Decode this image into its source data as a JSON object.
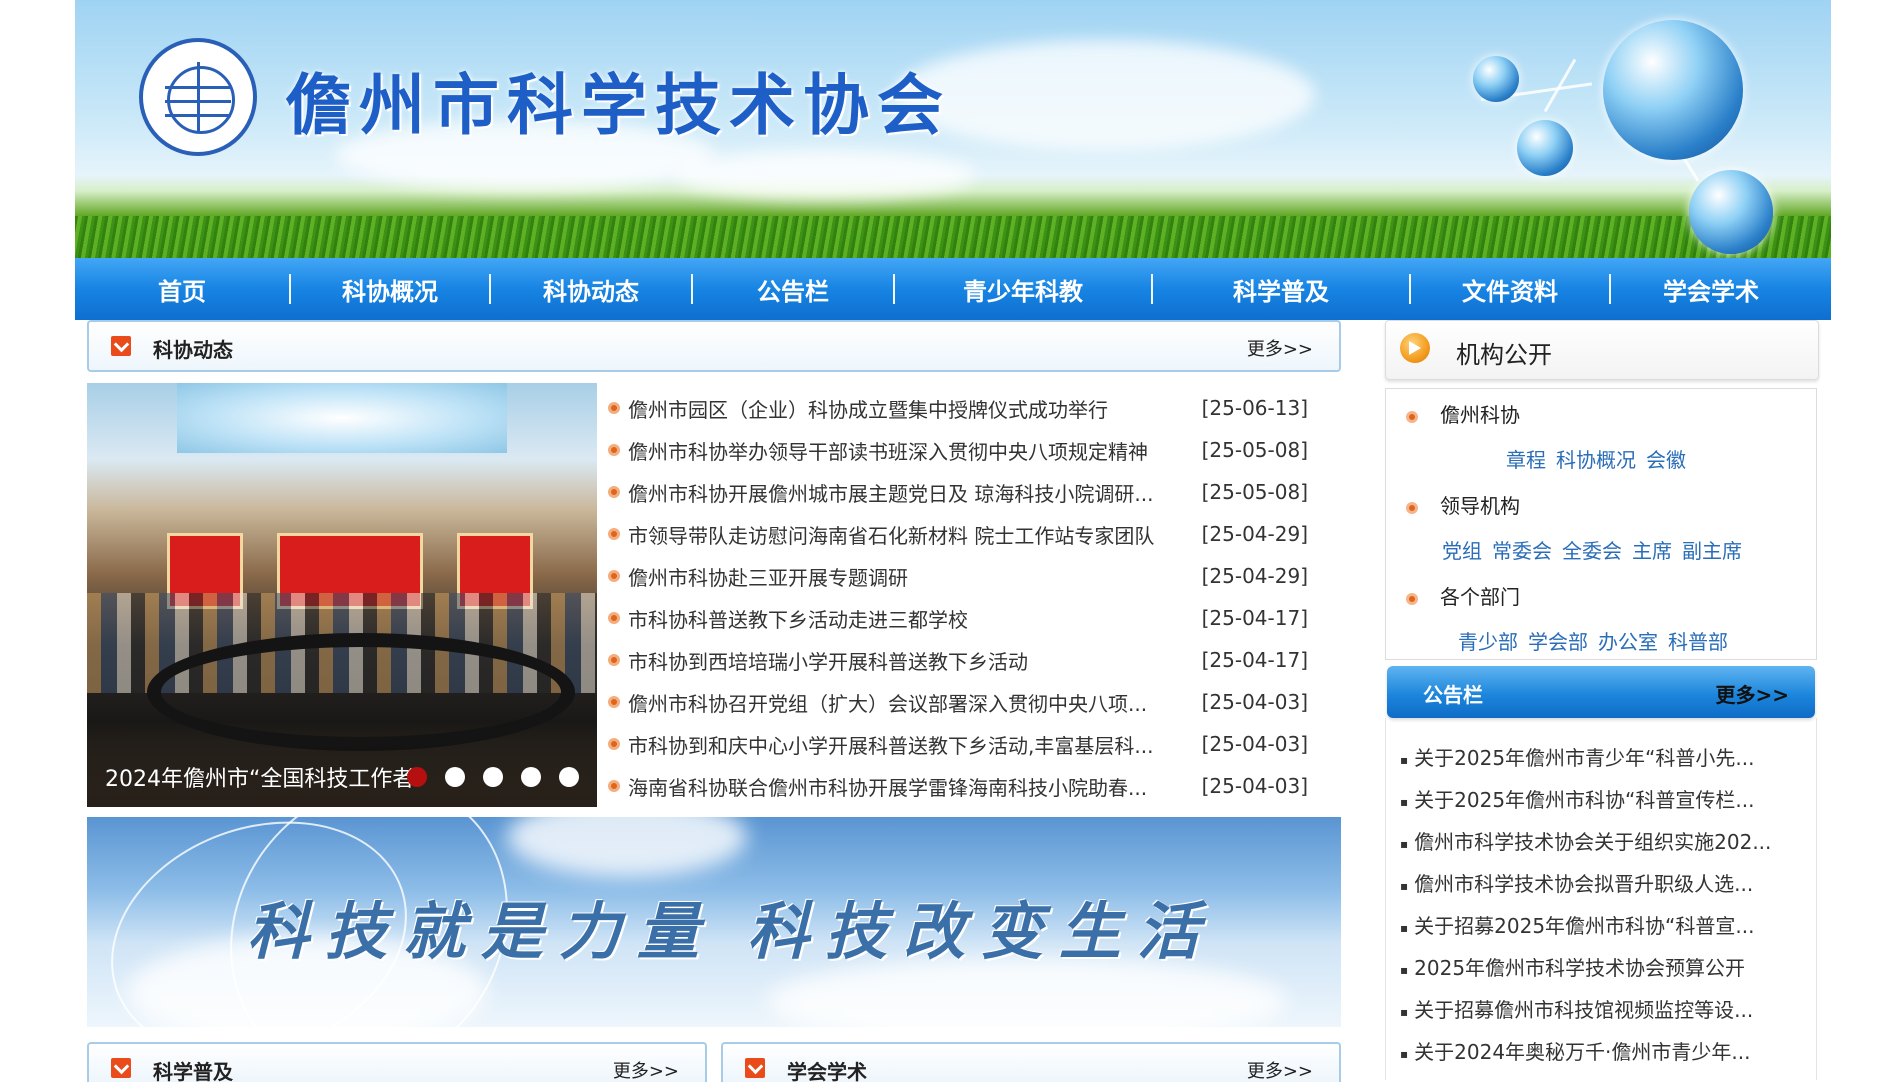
{
  "header": {
    "site_title": "儋州市科学技术协会"
  },
  "nav": {
    "items": [
      {
        "label": "首页"
      },
      {
        "label": "科协概况"
      },
      {
        "label": "科协动态"
      },
      {
        "label": "公告栏"
      },
      {
        "label": "青少年科教"
      },
      {
        "label": "科学普及"
      },
      {
        "label": "文件资料"
      },
      {
        "label": "学会学术"
      }
    ]
  },
  "news": {
    "title": "科协动态",
    "more": "更多>>",
    "slider_caption": "2024年儋州市“全国科技工作者...",
    "items": [
      {
        "title": "儋州市园区（企业）科协成立暨集中授牌仪式成功举行",
        "date": "[25-06-13]"
      },
      {
        "title": "儋州市科协举办领导干部读书班深入贯彻中央八项规定精神",
        "date": "[25-05-08]"
      },
      {
        "title": "儋州市科协开展儋州城市展主题党日及 琼海科技小院调研...",
        "date": "[25-05-08]"
      },
      {
        "title": "市领导带队走访慰问海南省石化新材料 院士工作站专家团队",
        "date": "[25-04-29]"
      },
      {
        "title": "儋州市科协赴三亚开展专题调研",
        "date": "[25-04-29]"
      },
      {
        "title": "市科协科普送教下乡活动走进三都学校",
        "date": "[25-04-17]"
      },
      {
        "title": "市科协到西培培瑞小学开展科普送教下乡活动",
        "date": "[25-04-17]"
      },
      {
        "title": "儋州市科协召开党组（扩大）会议部署深入贯彻中央八项...",
        "date": "[25-04-03]"
      },
      {
        "title": "市科协到和庆中心小学开展科普送教下乡活动,丰富基层科...",
        "date": "[25-04-03]"
      },
      {
        "title": "海南省科协联合儋州市科协开展学雷锋海南科技小院助春...",
        "date": "[25-04-03]"
      }
    ]
  },
  "slogan": {
    "left": "科技就是力量",
    "right": "科技改变生活"
  },
  "sections": {
    "popular_science": {
      "title": "科学普及",
      "more": "更多>>"
    },
    "academic": {
      "title": "学会学术",
      "more": "更多>>"
    }
  },
  "org": {
    "title": "机构公开",
    "groups": [
      {
        "name": "儋州科协",
        "links": [
          "章程",
          "科协概况",
          "会徽"
        ]
      },
      {
        "name": "领导机构",
        "links": [
          "党组",
          "常委会",
          "全委会",
          "主席",
          "副主席"
        ]
      },
      {
        "name": "各个部门",
        "links": [
          "青少部",
          "学会部",
          "办公室",
          "科普部"
        ]
      }
    ]
  },
  "notices": {
    "title": "公告栏",
    "more": "更多>>",
    "items": [
      "关于2025年儋州市青少年“科普小先...",
      "关于2025年儋州市科协“科普宣传栏...",
      "儋州市科学技术协会关于组织实施202...",
      "儋州市科学技术协会拟晋升职级人选...",
      "关于招募2025年儋州市科协“科普宣...",
      "2025年儋州市科学技术协会预算公开",
      "关于招募儋州市科技馆视频监控等设...",
      "关于2024年奥秘万千·儋州市青少年..."
    ]
  },
  "colors": {
    "nav_blue": "#1784e3",
    "title_blue": "#1e5ec7",
    "link_blue": "#2a6db8",
    "accent_orange": "#e0651a",
    "icon_red": "#e94b1b"
  }
}
